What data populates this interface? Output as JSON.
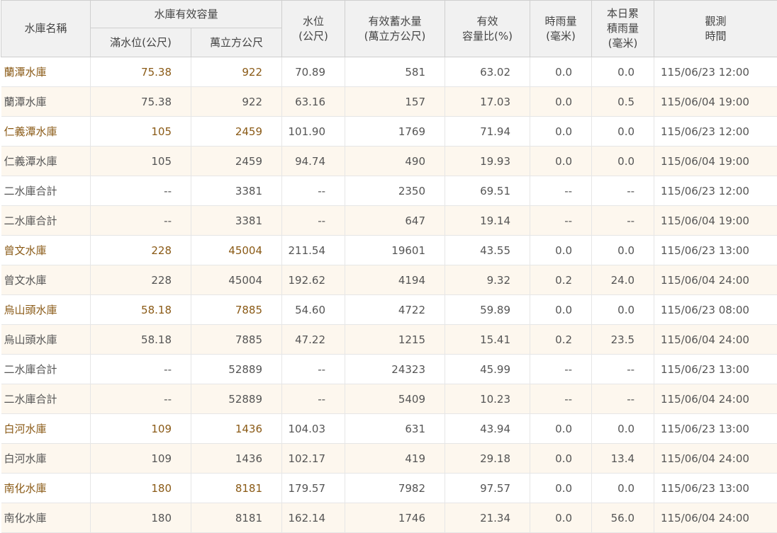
{
  "header": {
    "name": "水庫名稱",
    "capacity_group": "水庫有效容量",
    "full_level": "滿水位(公尺)",
    "capacity_volume": "萬立方公尺",
    "level_line1": "水位",
    "level_line2": "(公尺)",
    "storage_line1": "有效蓄水量",
    "storage_line2": "(萬立方公尺)",
    "ratio_line1": "有效",
    "ratio_line2": "容量比(%)",
    "hourly_line1": "時雨量",
    "hourly_line2": "(毫米)",
    "daily_line1": "本日累",
    "daily_line2": "積雨量",
    "daily_line3": "(毫米)",
    "time_line1": "觀測",
    "time_line2": "時間"
  },
  "rows": [
    {
      "name": "蘭潭水庫",
      "full": "75.38",
      "cap": "922",
      "level": "70.89",
      "storage": "581",
      "ratio": "63.02",
      "hourly": "0.0",
      "daily": "0.0",
      "time": "115/06/23 12:00",
      "linked": true
    },
    {
      "name": "蘭潭水庫",
      "full": "75.38",
      "cap": "922",
      "level": "63.16",
      "storage": "157",
      "ratio": "17.03",
      "hourly": "0.0",
      "daily": "0.5",
      "time": "115/06/04 19:00",
      "linked": false
    },
    {
      "name": "仁義潭水庫",
      "full": "105",
      "cap": "2459",
      "level": "101.90",
      "storage": "1769",
      "ratio": "71.94",
      "hourly": "0.0",
      "daily": "0.0",
      "time": "115/06/23 12:00",
      "linked": true
    },
    {
      "name": "仁義潭水庫",
      "full": "105",
      "cap": "2459",
      "level": "94.74",
      "storage": "490",
      "ratio": "19.93",
      "hourly": "0.0",
      "daily": "0.0",
      "time": "115/06/04 19:00",
      "linked": false
    },
    {
      "name": "二水庫合計",
      "full": "--",
      "cap": "3381",
      "level": "--",
      "storage": "2350",
      "ratio": "69.51",
      "hourly": "--",
      "daily": "--",
      "time": "115/06/23 12:00",
      "linked": false
    },
    {
      "name": "二水庫合計",
      "full": "--",
      "cap": "3381",
      "level": "--",
      "storage": "647",
      "ratio": "19.14",
      "hourly": "--",
      "daily": "--",
      "time": "115/06/04 19:00",
      "linked": false
    },
    {
      "name": "曾文水庫",
      "full": "228",
      "cap": "45004",
      "level": "211.54",
      "storage": "19601",
      "ratio": "43.55",
      "hourly": "0.0",
      "daily": "0.0",
      "time": "115/06/23 13:00",
      "linked": true
    },
    {
      "name": "曾文水庫",
      "full": "228",
      "cap": "45004",
      "level": "192.62",
      "storage": "4194",
      "ratio": "9.32",
      "hourly": "0.2",
      "daily": "24.0",
      "time": "115/06/04 24:00",
      "linked": false
    },
    {
      "name": "烏山頭水庫",
      "full": "58.18",
      "cap": "7885",
      "level": "54.60",
      "storage": "4722",
      "ratio": "59.89",
      "hourly": "0.0",
      "daily": "0.0",
      "time": "115/06/23 08:00",
      "linked": true
    },
    {
      "name": "烏山頭水庫",
      "full": "58.18",
      "cap": "7885",
      "level": "47.22",
      "storage": "1215",
      "ratio": "15.41",
      "hourly": "0.2",
      "daily": "23.5",
      "time": "115/06/04 24:00",
      "linked": false
    },
    {
      "name": "二水庫合計",
      "full": "--",
      "cap": "52889",
      "level": "--",
      "storage": "24323",
      "ratio": "45.99",
      "hourly": "--",
      "daily": "--",
      "time": "115/06/23 13:00",
      "linked": false
    },
    {
      "name": "二水庫合計",
      "full": "--",
      "cap": "52889",
      "level": "--",
      "storage": "5409",
      "ratio": "10.23",
      "hourly": "--",
      "daily": "--",
      "time": "115/06/04 24:00",
      "linked": false
    },
    {
      "name": "白河水庫",
      "full": "109",
      "cap": "1436",
      "level": "104.03",
      "storage": "631",
      "ratio": "43.94",
      "hourly": "0.0",
      "daily": "0.0",
      "time": "115/06/23 13:00",
      "linked": true
    },
    {
      "name": "白河水庫",
      "full": "109",
      "cap": "1436",
      "level": "102.17",
      "storage": "419",
      "ratio": "29.18",
      "hourly": "0.0",
      "daily": "13.4",
      "time": "115/06/04 24:00",
      "linked": false
    },
    {
      "name": "南化水庫",
      "full": "180",
      "cap": "8181",
      "level": "179.57",
      "storage": "7982",
      "ratio": "97.57",
      "hourly": "0.0",
      "daily": "0.0",
      "time": "115/06/23 13:00",
      "linked": true
    },
    {
      "name": "南化水庫",
      "full": "180",
      "cap": "8181",
      "level": "162.14",
      "storage": "1746",
      "ratio": "21.34",
      "hourly": "0.0",
      "daily": "56.0",
      "time": "115/06/04 24:00",
      "linked": false
    }
  ],
  "colors": {
    "header_bg": "#f1f1f1",
    "alt_row_bg": "#fdf7ee",
    "link_text": "#8a5a16",
    "body_text": "#555555"
  }
}
